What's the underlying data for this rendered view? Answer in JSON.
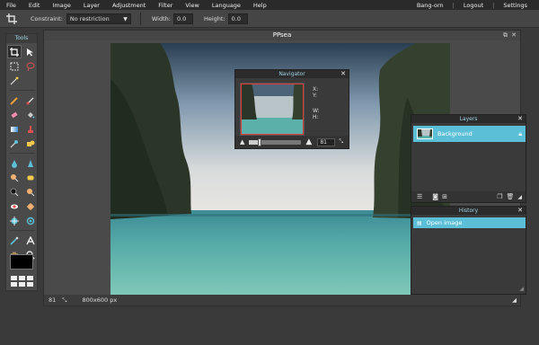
{
  "menubar": {
    "items": [
      "File",
      "Edit",
      "Image",
      "Layer",
      "Adjustment",
      "Filter",
      "View",
      "Language",
      "Help"
    ],
    "user": "Bang-orn",
    "logout": "Logout",
    "settings": "Settings",
    "sep": "|"
  },
  "options": {
    "constraint_label": "Constraint:",
    "constraint_value": "No restriction",
    "width_label": "Width:",
    "width_value": "0.0",
    "height_label": "Height:",
    "height_value": "0.0"
  },
  "tools": {
    "title": "Tools"
  },
  "document": {
    "title": "PPsea",
    "zoom": "81",
    "size": "800x600 px"
  },
  "navigator": {
    "title": "Navigator",
    "x_label": "X:",
    "y_label": "Y:",
    "w_label": "W:",
    "h_label": "H:",
    "zoom": "81",
    "zoom_level": 0.2
  },
  "layers": {
    "title": "Layers",
    "items": [
      {
        "name": "Background"
      }
    ]
  },
  "history": {
    "title": "History",
    "items": [
      {
        "label": "Open image"
      }
    ]
  },
  "colors": {
    "accent": "#5bbfd7",
    "primary_color": "#000000"
  }
}
